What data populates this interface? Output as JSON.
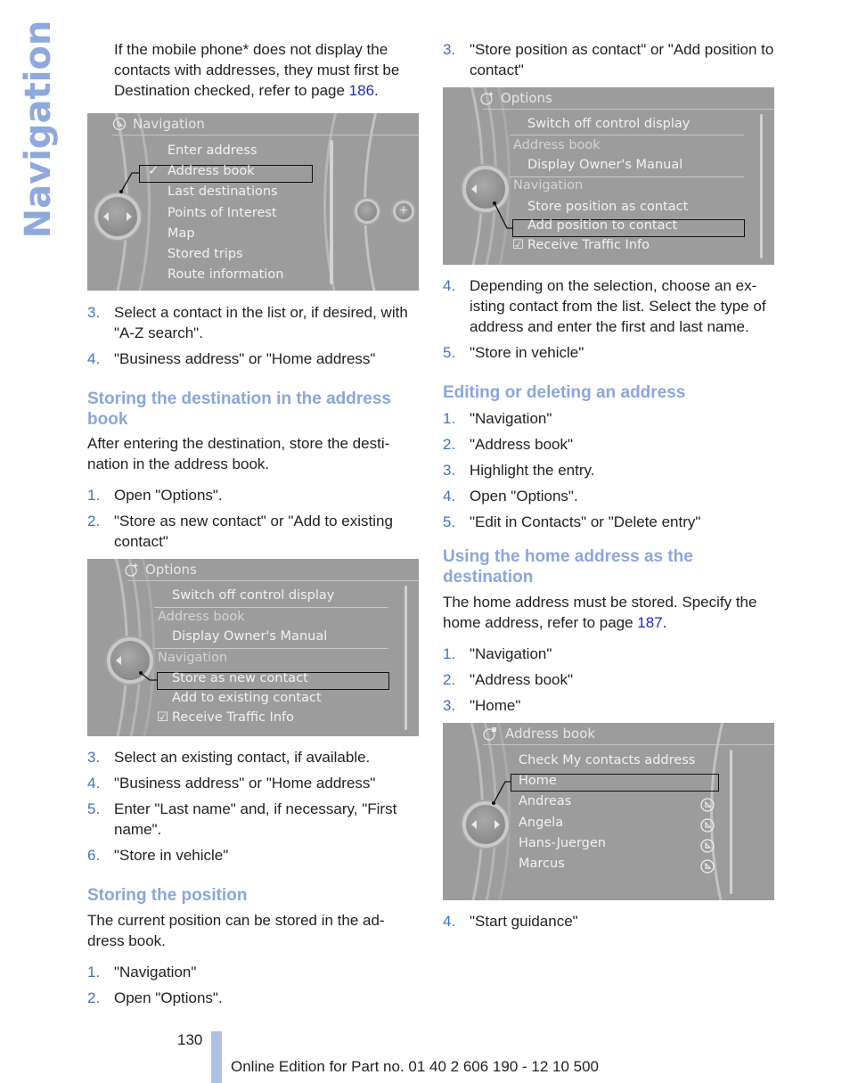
{
  "side_tab": {
    "label": "Navigation"
  },
  "colors": {
    "accent_heading": "#8aa6db",
    "step_number": "#3e73c4",
    "link": "#1b2bc9",
    "side_tab": "#8fa9dc",
    "footer_bar": "#b1c0e6"
  },
  "left": {
    "intro": {
      "text_before": "If the mobile phone* does not display the contacts with addresses, they must first be Destination checked, refer to page ",
      "link": "186",
      "text_after": "."
    },
    "screen1": {
      "title": "Navigation",
      "title_icon": "navigation-icon",
      "items": [
        "Enter address",
        "Address book",
        "Last destinations",
        "Points of Interest",
        "Map",
        "Stored trips",
        "Route information"
      ],
      "checked_item": "Address book",
      "selected_index": 1,
      "right_icons": [
        "map-options-icon",
        "plus-icon"
      ]
    },
    "steps_a": [
      {
        "num": "3.",
        "text": "Select a contact in the list or, if desired, with \"A-Z search\"."
      },
      {
        "num": "4.",
        "text": "\"Business address\" or \"Home address\""
      }
    ],
    "section1": {
      "heading": "Storing the destination in the address book",
      "body": "After entering the destination, store the desti-nation in the address book.",
      "steps": [
        {
          "num": "1.",
          "text": "Open \"Options\"."
        },
        {
          "num": "2.",
          "text": "\"Store as new contact\" or \"Add to existing contact\""
        }
      ]
    },
    "screen2": {
      "title": "Options",
      "items": [
        {
          "label": "Switch off control display",
          "type": "item"
        },
        {
          "label": "Address book",
          "type": "group"
        },
        {
          "label": "Display Owner's Manual",
          "type": "item"
        },
        {
          "label": "Navigation",
          "type": "group"
        },
        {
          "label": "Store as new contact",
          "type": "item",
          "selected": true
        },
        {
          "label": "Add to existing contact",
          "type": "item"
        },
        {
          "label": "Receive Traffic Info",
          "type": "checkbox",
          "checked": true
        }
      ]
    },
    "steps_b": [
      {
        "num": "3.",
        "text": "Select an existing contact, if available."
      },
      {
        "num": "4.",
        "text": "\"Business address\" or \"Home address\""
      },
      {
        "num": "5.",
        "text": "Enter \"Last name\" and, if necessary, \"First name\"."
      },
      {
        "num": "6.",
        "text": "\"Store in vehicle\""
      }
    ],
    "section2": {
      "heading": "Storing the position",
      "body": "The current position can be stored in the ad-dress book.",
      "steps": [
        {
          "num": "1.",
          "text": "\"Navigation\""
        },
        {
          "num": "2.",
          "text": "Open \"Options\"."
        }
      ]
    }
  },
  "right": {
    "step_top": {
      "num": "3.",
      "text": "\"Store position as contact\" or \"Add position to contact\""
    },
    "screen3": {
      "title": "Options",
      "items": [
        {
          "label": "Switch off control display",
          "type": "item"
        },
        {
          "label": "Address book",
          "type": "group"
        },
        {
          "label": "Display Owner's Manual",
          "type": "item"
        },
        {
          "label": "Navigation",
          "type": "group"
        },
        {
          "label": "Store position as contact",
          "type": "item"
        },
        {
          "label": "Add position to contact",
          "type": "item",
          "selected": true
        },
        {
          "label": "Receive Traffic Info",
          "type": "checkbox",
          "checked": true
        }
      ]
    },
    "steps_a": [
      {
        "num": "4.",
        "text": "Depending on the selection, choose an ex-isting contact from the list. Select the type of address and enter the first and last name."
      },
      {
        "num": "5.",
        "text": "\"Store in vehicle\""
      }
    ],
    "section1": {
      "heading": "Editing or deleting an address",
      "steps": [
        {
          "num": "1.",
          "text": "\"Navigation\""
        },
        {
          "num": "2.",
          "text": "\"Address book\""
        },
        {
          "num": "3.",
          "text": "Highlight the entry."
        },
        {
          "num": "4.",
          "text": "Open \"Options\"."
        },
        {
          "num": "5.",
          "text": "\"Edit in Contacts\" or \"Delete entry\""
        }
      ]
    },
    "section2": {
      "heading": "Using the home address as the destination",
      "body_before": "The home address must be stored. Specify the home address, refer to page ",
      "link": "187",
      "body_after": ".",
      "steps": [
        {
          "num": "1.",
          "text": "\"Navigation\""
        },
        {
          "num": "2.",
          "text": "\"Address book\""
        },
        {
          "num": "3.",
          "text": "\"Home\""
        }
      ]
    },
    "screen4": {
      "title": "Address book",
      "items": [
        {
          "label": "Check My contacts address",
          "nav_icon": false
        },
        {
          "label": "Home",
          "nav_icon": false,
          "selected": true
        },
        {
          "label": "Andreas",
          "nav_icon": true
        },
        {
          "label": "Angela",
          "nav_icon": true
        },
        {
          "label": "Hans-Juergen",
          "nav_icon": true
        },
        {
          "label": "Marcus",
          "nav_icon": true
        }
      ]
    },
    "step_last": {
      "num": "4.",
      "text": "\"Start guidance\""
    }
  },
  "footer": {
    "page_number": "130",
    "edition": "Online Edition for Part no. 01 40 2 606 190 - 12 10 500"
  }
}
